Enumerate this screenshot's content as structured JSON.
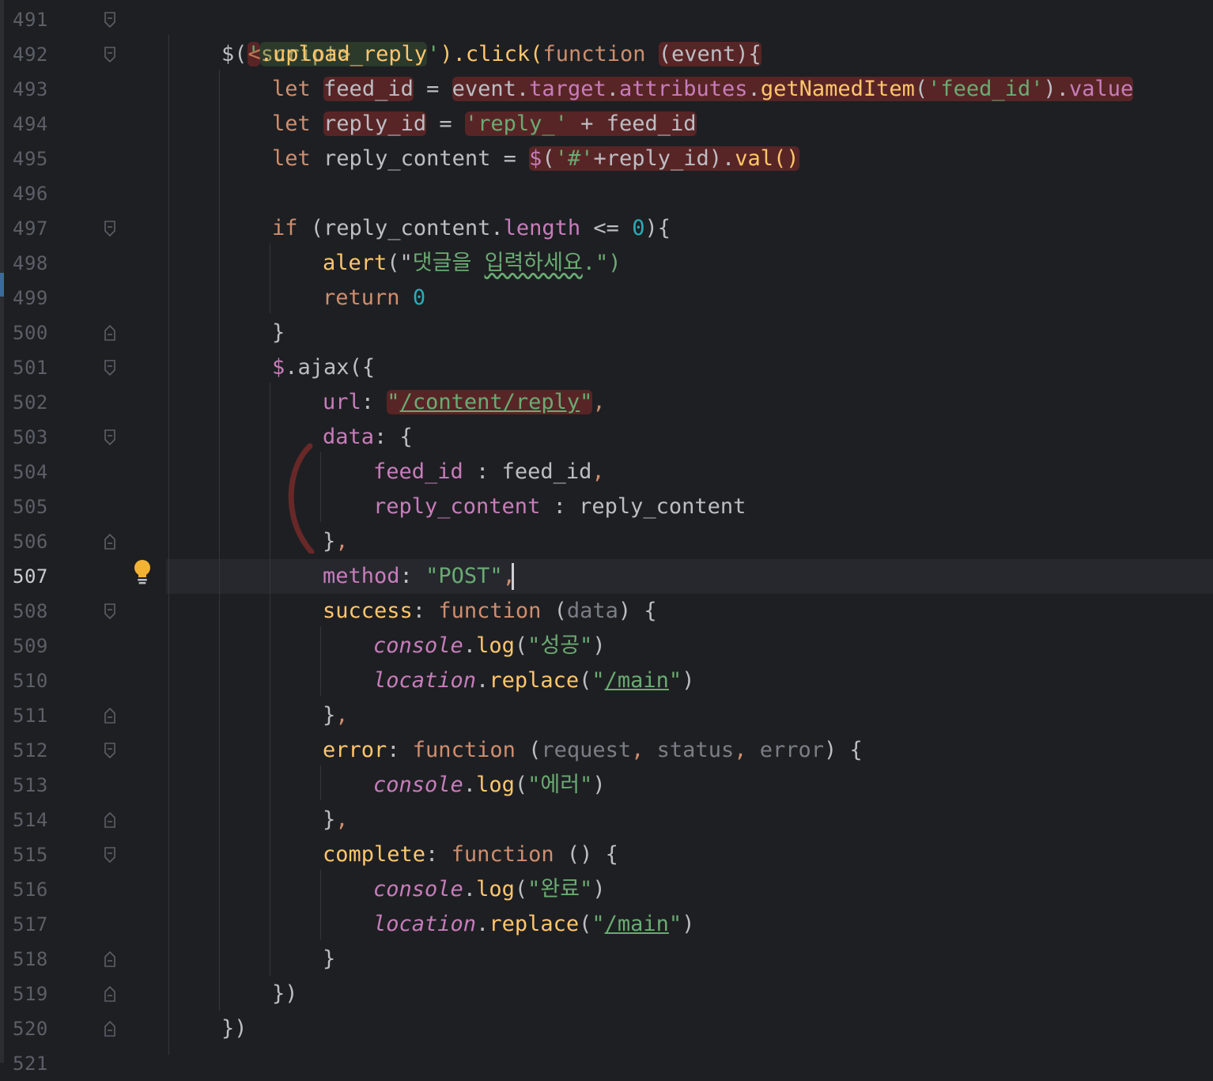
{
  "editor": {
    "current_line": "507",
    "lines": [
      {
        "num": "491",
        "code": "<script>"
      },
      {
        "num": "492",
        "code": "$('.upload_reply').click(function (event){"
      },
      {
        "num": "493",
        "code": "let feed_id = event.target.attributes.getNamedItem('feed_id').value"
      },
      {
        "num": "494",
        "code": "let reply_id = 'reply_' + feed_id"
      },
      {
        "num": "495",
        "code": "let reply_content = $('#'+reply_id).val()"
      },
      {
        "num": "496",
        "code": ""
      },
      {
        "num": "497",
        "code": "if (reply_content.length <= 0){"
      },
      {
        "num": "498",
        "code": "alert(\"댓글을 입력하세요.\")"
      },
      {
        "num": "499",
        "code": "return 0"
      },
      {
        "num": "500",
        "code": "}"
      },
      {
        "num": "501",
        "code": "$.ajax({"
      },
      {
        "num": "502",
        "code": "url: \"/content/reply\","
      },
      {
        "num": "503",
        "code": "data: {"
      },
      {
        "num": "504",
        "code": "feed_id : feed_id,"
      },
      {
        "num": "505",
        "code": "reply_content : reply_content"
      },
      {
        "num": "506",
        "code": "},"
      },
      {
        "num": "507",
        "code": "method: \"POST\","
      },
      {
        "num": "508",
        "code": "success: function (data) {"
      },
      {
        "num": "509",
        "code": "console.log(\"성공\")"
      },
      {
        "num": "510",
        "code": "location.replace(\"/main\")"
      },
      {
        "num": "511",
        "code": "},"
      },
      {
        "num": "512",
        "code": "error: function (request, status, error) {"
      },
      {
        "num": "513",
        "code": "console.log(\"에러\")"
      },
      {
        "num": "514",
        "code": "},"
      },
      {
        "num": "515",
        "code": "complete: function () {"
      },
      {
        "num": "516",
        "code": "console.log(\"완료\")"
      },
      {
        "num": "517",
        "code": "location.replace(\"/main\")"
      },
      {
        "num": "518",
        "code": "}"
      },
      {
        "num": "519",
        "code": "})"
      },
      {
        "num": "520",
        "code": "})"
      },
      {
        "num": "521",
        "code": ""
      }
    ]
  },
  "tokens": {
    "script_tag": "<script>",
    "dollar": "$",
    "open_paren": "(",
    "quote": "'",
    "upload_reply": ".upload_reply",
    "close_click": ").click(",
    "function": "function",
    "event_param": "(event){",
    "let": "let",
    "feed_id": "feed_id",
    "eq": " = ",
    "event": "event",
    "dot": ".",
    "target": "target",
    "attributes": "attributes",
    "getNamedItem": "getNamedItem",
    "feed_id_str": "'feed_id'",
    "close_paren_dot": ").",
    "value": "value",
    "reply_id": "reply_id",
    "reply_prefix": "'reply_'",
    "plus": " + ",
    "reply_content": "reply_content",
    "hash_str": "'#'",
    "plus_reply_id": "+reply_id).",
    "val": "val()",
    "if": "if",
    "reply_content_paren": " (reply_content.",
    "length": "length",
    "lte": " <= ",
    "zero": "0",
    "close_brace_open": "){",
    "alert": "alert",
    "alert_open": "(\"",
    "alert_msg_1": "댓글을 ",
    "alert_msg_2": "입력하세요",
    "alert_close": ".\")",
    "return": "return",
    "close_brace": "}",
    "ajax": "ajax",
    "ajax_open": "({",
    "url": "url",
    "colon": ": ",
    "url_value": "/content/reply",
    "dq": "\"",
    "comma": ",",
    "data": "data",
    "open_brace": "{",
    "key_sep": " : ",
    "close_brace_comma": "},",
    "method": "method",
    "post": "\"POST\"",
    "success": "success",
    "data_param": "data",
    "console": "console",
    "log": "log",
    "success_msg": "\"성공\"",
    "location": "location",
    "replace": "replace",
    "main_path": "/main",
    "error": "error",
    "request": "request",
    "status": "status",
    "error_msg": "\"에러\"",
    "complete": "complete",
    "complete_msg": "\"완료\"",
    "close_paren_braces": "})",
    "paren_close": ")",
    "open_paren_space": " (",
    "close_paren_space_brace": ") {",
    "empty_parens": " () {",
    "comma_space": ", "
  },
  "colors": {
    "background": "#1e1f22",
    "keyword": "#cf8e6d",
    "string": "#6aab73",
    "property": "#c77dbb",
    "function_call": "#ffc66d",
    "number": "#2aacb8",
    "tag": "#d5b778",
    "plain": "#bcbec4",
    "line_number": "#5b5f67",
    "bulb": "#f2b233"
  },
  "icons": [
    "fold-marker-icon",
    "intention-bulb-icon"
  ]
}
